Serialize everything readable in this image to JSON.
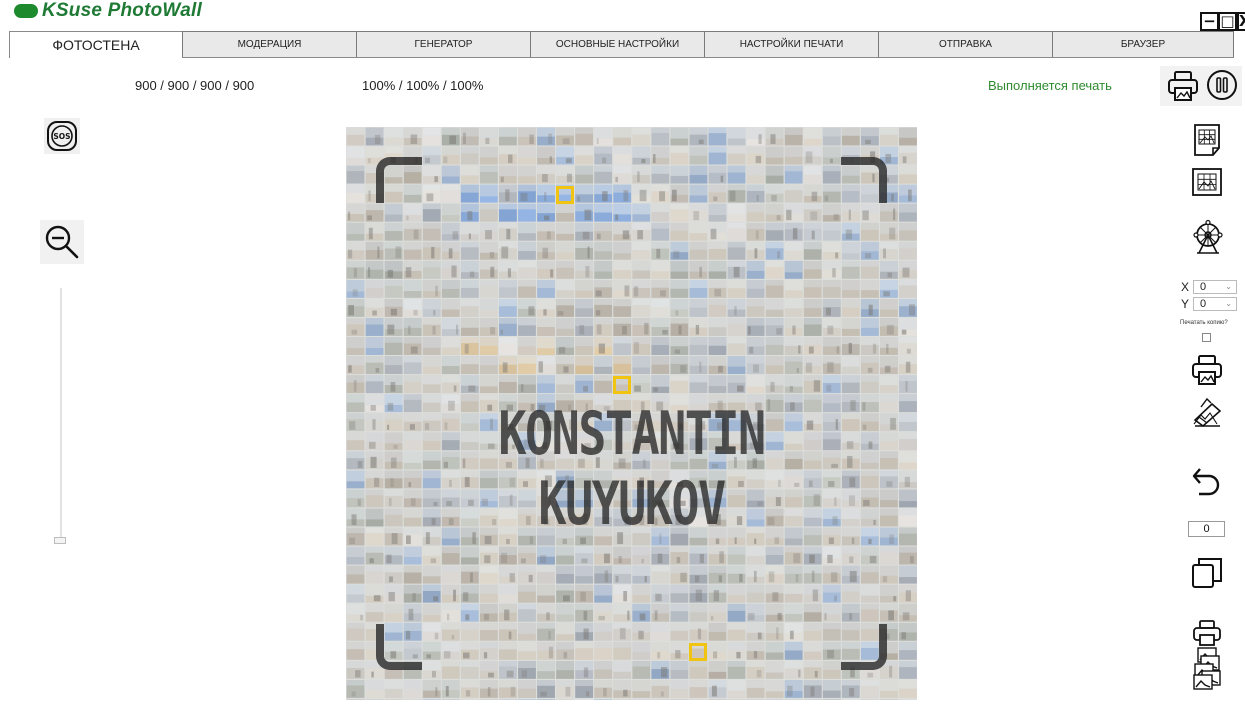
{
  "app": {
    "title": "KSuse PhotoWall",
    "brand_color": "#1e8a2e"
  },
  "window_controls": {
    "minimize": "−",
    "maximize": "□",
    "close": "X"
  },
  "tabs": [
    {
      "label": "ФОТОСТЕНА",
      "active": true
    },
    {
      "label": "МОДЕРАЦИЯ",
      "active": false
    },
    {
      "label": "ГЕНЕРАТОР",
      "active": false
    },
    {
      "label": "ОСНОВНЫЕ НАСТРОЙКИ",
      "active": false
    },
    {
      "label": "НАСТРОЙКИ ПЕЧАТИ",
      "active": false
    },
    {
      "label": "ОТПРАВКА",
      "active": false
    },
    {
      "label": "БРАУЗЕР",
      "active": false
    }
  ],
  "status": {
    "resolution": "900 / 900 / 900 / 900",
    "scale": "100% / 100% / 100%",
    "print_state": "Выполняется печать",
    "print_state_color": "#2e8b2e"
  },
  "left_panel": {
    "sos_label": "SOS",
    "icons": [
      "sos-icon",
      "zoom-out-icon"
    ],
    "zoom_level": 0
  },
  "wall": {
    "overlay_lines": [
      "KONSTANTIN",
      "KUYUKOV"
    ],
    "marker_color": "#f2c412"
  },
  "right_panel": {
    "coords": {
      "x_label": "X",
      "x_value": "0",
      "y_label": "Y",
      "y_value": "0"
    },
    "print_copy_label": "Печатать копию?",
    "print_copy_checked": false,
    "counter": "0",
    "icons": [
      "printer-icon",
      "pause-icon",
      "page-grid-icon",
      "grid-frame-icon",
      "ferris-wheel-icon",
      "printer-icon",
      "eraser-icon",
      "undo-icon",
      "copy-icon",
      "batch-print-icon"
    ]
  }
}
